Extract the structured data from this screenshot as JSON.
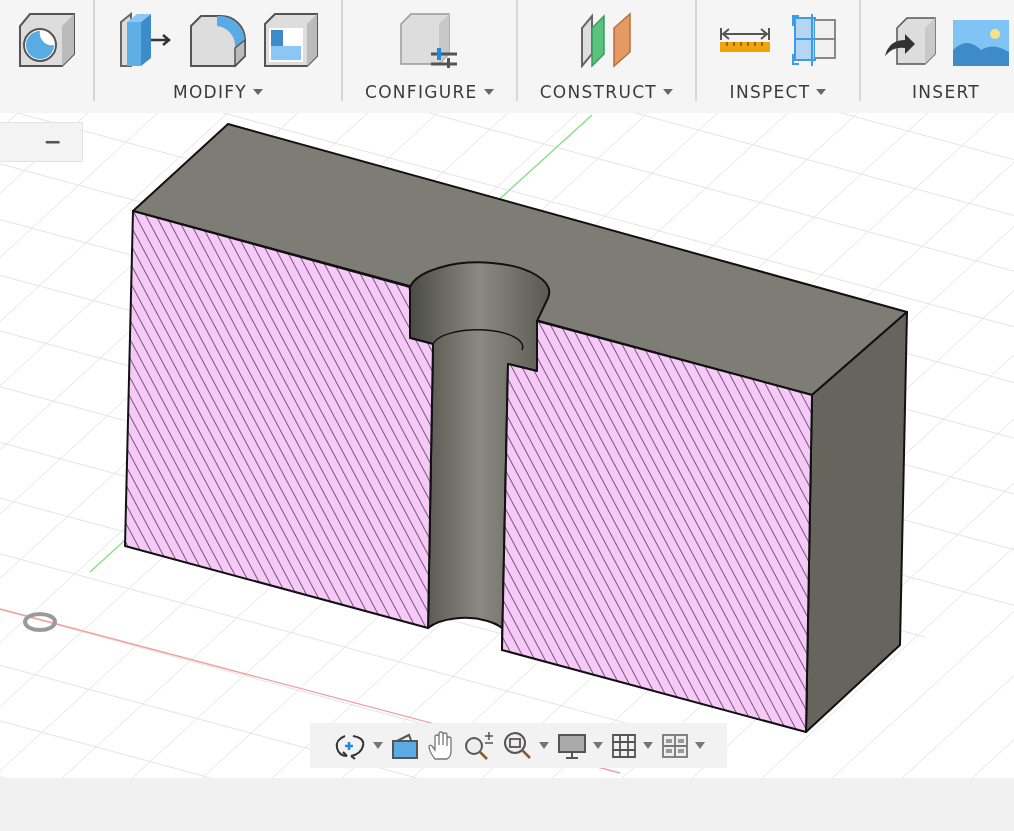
{
  "toolbar": {
    "groups": [
      {
        "label": "MODIFY",
        "dropdown": true
      },
      {
        "label": "CONFIGURE",
        "dropdown": true
      },
      {
        "label": "CONSTRUCT",
        "dropdown": true
      },
      {
        "label": "INSPECT",
        "dropdown": true
      },
      {
        "label": "INSERT",
        "dropdown": false
      }
    ]
  },
  "browser_panel": {
    "collapse_label": "−"
  },
  "navbar": [
    {
      "kind": "orbit",
      "dropdown": true
    },
    {
      "kind": "look",
      "dropdown": false
    },
    {
      "kind": "pan",
      "dropdown": false
    },
    {
      "kind": "zoom",
      "dropdown": false
    },
    {
      "kind": "fit",
      "dropdown": true
    },
    {
      "kind": "display",
      "dropdown": true
    },
    {
      "kind": "grid",
      "dropdown": true
    },
    {
      "kind": "viewports",
      "dropdown": true
    }
  ]
}
